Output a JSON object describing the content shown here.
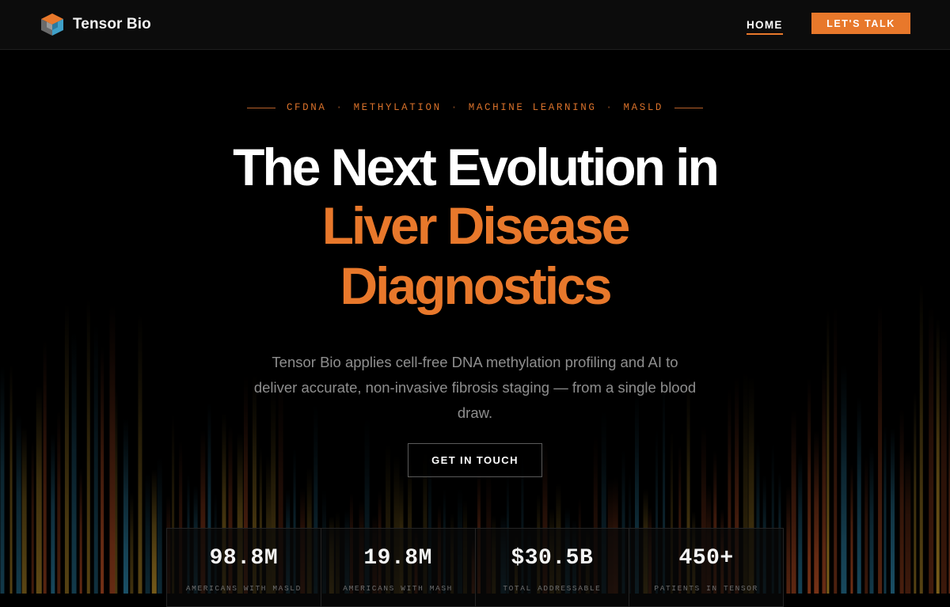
{
  "brand": {
    "name": "Tensor Bio",
    "logo_icon": "cube-logo-icon"
  },
  "nav": {
    "home_label": "HOME",
    "cta_label": "LET'S TALK"
  },
  "hero": {
    "tags": [
      "CFDNA",
      "METHYLATION",
      "MACHINE LEARNING",
      "MASLD"
    ],
    "tag_separator": "·",
    "headline_line1": "The Next Evolution in",
    "headline_line2": "Liver Disease",
    "headline_line3": "Diagnostics",
    "lead": "Tensor Bio applies cell-free DNA methylation profiling and AI to deliver accurate, non-invasive fibrosis staging — from a single blood draw.",
    "cta_label": "GET IN TOUCH"
  },
  "stats": [
    {
      "value": "98.8M",
      "label": "AMERICANS WITH MASLD"
    },
    {
      "value": "19.8M",
      "label": "AMERICANS WITH MASH"
    },
    {
      "value": "$30.5B",
      "label": "TOTAL ADDRESSABLE"
    },
    {
      "value": "450+",
      "label": "PATIENTS IN TENSOR"
    }
  ],
  "colors": {
    "accent": "#e8782b",
    "background": "#000000",
    "nav_bg": "#0c0c0c",
    "text_primary": "#ffffff",
    "text_muted": "#8e8e8e",
    "viz_teal": "#1f5f7a",
    "viz_gold": "#8a6a1e",
    "viz_rust": "#8a3a1a"
  }
}
